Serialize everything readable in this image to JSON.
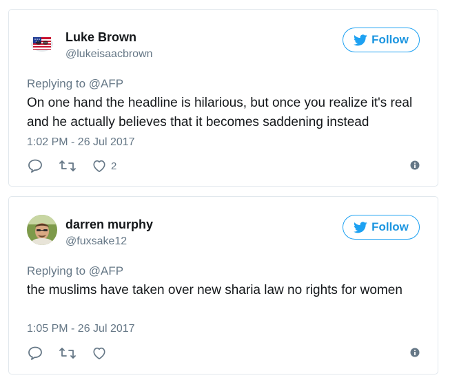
{
  "tweets": [
    {
      "display_name": "Luke Brown",
      "handle": "@lukeisaacbrown",
      "follow_label": "Follow",
      "replying_prefix": "Replying to",
      "replying_to": "@AFP",
      "text": "On one hand the headline is hilarious, but once you realize it's real and he actually believes that it becomes saddening instead",
      "timestamp": "1:02 PM - 26 Jul 2017",
      "like_count": "2",
      "avatar": "flag-avatar"
    },
    {
      "display_name": "darren murphy",
      "handle": "@fuxsake12",
      "follow_label": "Follow",
      "replying_prefix": "Replying to",
      "replying_to": "@AFP",
      "text": "the muslims have taken over new sharia law no rights for women",
      "timestamp": "1:05 PM - 26 Jul 2017",
      "like_count": "",
      "avatar": "person-avatar"
    }
  ],
  "colors": {
    "accent": "#1da1f2",
    "secondary_text": "#657786",
    "primary_text": "#14171a",
    "border": "#e1e8ed"
  }
}
